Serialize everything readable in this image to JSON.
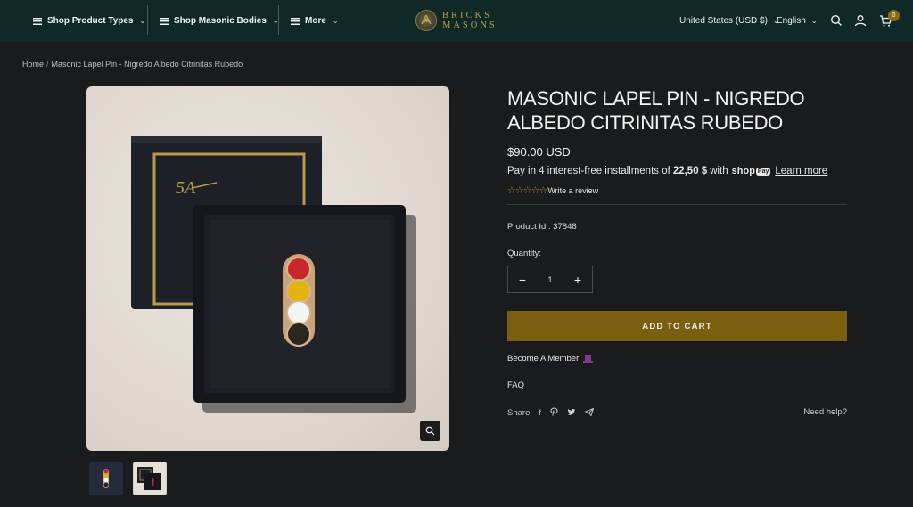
{
  "header": {
    "nav": [
      {
        "label": "Shop Product Types"
      },
      {
        "label": "Shop Masonic Bodies"
      },
      {
        "label": "More"
      }
    ],
    "logo_text_line1": "BRICKS",
    "logo_text_line2": "MASONS",
    "currency": "United States (USD $)",
    "language": "English",
    "cart_count": "0"
  },
  "breadcrumb": {
    "home": "Home",
    "separator": "/",
    "current": "Masonic Lapel Pin - Nigredo Albedo Citrinitas Rubedo"
  },
  "product": {
    "title": "MASONIC LAPEL PIN - NIGREDO ALBEDO CITRINITAS RUBEDO",
    "price": "$90.00 USD",
    "installments_prefix": "Pay in 4 interest-free installments of",
    "installment_amount": "22,50 $",
    "installments_suffix": "with",
    "shop_pay_label": "shop",
    "shop_pay_badge": "Pay",
    "learn_more": "Learn more",
    "rating_stars": "☆☆☆☆☆",
    "write_review": "Write a review",
    "product_id": "Product Id : 37848",
    "quantity_label": "Quantity:",
    "quantity_value": "1",
    "add_to_cart": "ADD TO CART",
    "become_member": "Become A Member",
    "faq": "FAQ",
    "share_label": "Share",
    "need_help": "Need help?"
  },
  "colors": {
    "header_bg": "#0f2a26",
    "page_bg": "#1a1b1d",
    "add_to_cart_bg": "#7a5f10",
    "star_color": "#c99a2e",
    "pin_red": "#c8262b",
    "pin_yellow": "#e3b40d",
    "pin_white": "#f2f4f6",
    "pin_black": "#2a2620"
  }
}
